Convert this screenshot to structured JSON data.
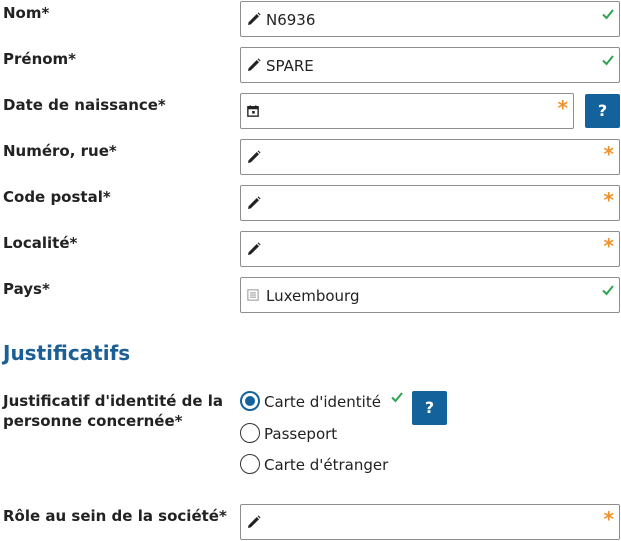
{
  "colors": {
    "accent": "#14629b",
    "valid": "#2ea44f",
    "required": "#f0922b",
    "section_title": "#1b5f95"
  },
  "fields": {
    "nom": {
      "label": "Nom*",
      "value": "N6936",
      "icon": "pencil-icon",
      "status": "valid"
    },
    "prenom": {
      "label": "Prénom*",
      "value": "SPARE",
      "icon": "pencil-icon",
      "status": "valid"
    },
    "date_naissance": {
      "label": "Date de naissance*",
      "value": "",
      "icon": "calendar-icon",
      "status": "required",
      "required_mark": "*"
    },
    "numero_rue": {
      "label": "Numéro, rue*",
      "value": "",
      "icon": "pencil-icon",
      "status": "required",
      "required_mark": "*"
    },
    "code_postal": {
      "label": "Code postal*",
      "value": "",
      "icon": "pencil-icon",
      "status": "required",
      "required_mark": "*"
    },
    "localite": {
      "label": "Localité*",
      "value": "",
      "icon": "pencil-icon",
      "status": "required",
      "required_mark": "*"
    },
    "pays": {
      "label": "Pays*",
      "value": "Luxembourg",
      "icon": "list-icon",
      "status": "valid"
    },
    "role": {
      "label": "Rôle au sein de la société*",
      "value": "",
      "icon": "pencil-icon",
      "status": "required",
      "required_mark": "*"
    }
  },
  "help_label": "?",
  "justificatifs": {
    "title": "Justificatifs",
    "identity_label_line1": "Justificatif d'identité de la",
    "identity_label_line2": "personne concernée*",
    "options": [
      {
        "label": "Carte d'identité",
        "checked": true
      },
      {
        "label": "Passeport",
        "checked": false
      },
      {
        "label": "Carte d'étranger",
        "checked": false
      }
    ]
  }
}
